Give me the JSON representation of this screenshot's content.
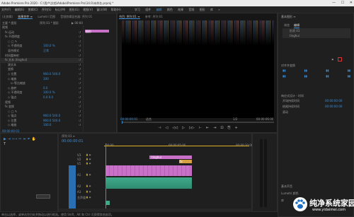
{
  "window": {
    "title": "Adobe Premiere Pro 2020 - C:\\用户\\文档\\Adobe\\Premiere Pro\\14.0\\未命名.prproj *",
    "controls": [
      "—",
      "☐",
      "✕"
    ]
  },
  "menu": [
    "文件(F)",
    "编辑(E)",
    "剪辑(C)",
    "序列(S)",
    "标记(M)",
    "图形(G)",
    "视图(V)",
    "窗口(W)",
    "帮助(H)"
  ],
  "workspaces": [
    "学习",
    "组件",
    "编辑",
    "颜色",
    "效果",
    "音频",
    "图形",
    "库",
    "»"
  ],
  "left_tabs": [
    "(无剪辑)",
    "效果控件 ≡",
    "Lumetri 范围",
    "音频剪辑混合器: 序列 01"
  ],
  "ec": {
    "source": "主要 * 图形",
    "seq": "序列 01 * 图形",
    "time": "▶ 00:00",
    "rows": [
      {
        "label": "视频",
        "indent": 0,
        "bold": true
      },
      {
        "label": "fx 运动",
        "indent": 1
      },
      {
        "label": "fx 不透明度",
        "indent": 1
      },
      {
        "label": "○ □ ✎",
        "indent": 2
      },
      {
        "label": "◇ 不透明度",
        "indent": 2,
        "value": "100.0 %"
      },
      {
        "label": "混合模式",
        "indent": 2,
        "value": "正常"
      },
      {
        "label": "时间重映射",
        "indent": 1
      },
      {
        "label": "fx 文本 (tinghui)",
        "indent": 1,
        "value": "",
        "hl": true
      },
      {
        "label": "源文本",
        "indent": 2
      },
      {
        "label": "变换",
        "indent": 2
      },
      {
        "label": "◇ 位置",
        "indent": 2,
        "value": "960.0   540.0"
      },
      {
        "label": "◇ 缩放",
        "indent": 2,
        "value": "100"
      },
      {
        "label": "☑ 等比缩放",
        "indent": 3
      },
      {
        "label": "◇ 旋转",
        "indent": 2,
        "value": "0.0"
      },
      {
        "label": "◇ 不透明度",
        "indent": 2,
        "value": "100.0 %"
      },
      {
        "label": "◇ 锚点",
        "indent": 2,
        "value": "0.0   0.0"
      },
      {
        "label": "视频",
        "indent": 1
      },
      {
        "label": "fx 变换",
        "indent": 1
      },
      {
        "label": "○ □ ✎",
        "indent": 2
      },
      {
        "label": "◇ 锚点",
        "indent": 2,
        "value": "960.0   540.0"
      },
      {
        "label": "◇ 位置",
        "indent": 2,
        "value": "960.0   540.0"
      },
      {
        "label": "◇ 缩放",
        "indent": 2,
        "value": "100.0"
      }
    ],
    "bottom_time": "00:00:00:01"
  },
  "clip_bar": "图形",
  "program": {
    "tabs": [
      "节目: 序列 01 ≡",
      "参考: 序列 01"
    ],
    "tc_left": "00:00:00:01",
    "fit": "适合",
    "full": "1/2",
    "tc_right": "00:00:06:00",
    "transport": [
      "⊣",
      "◁",
      "◁◁",
      "▷",
      "▷▷",
      "⊢",
      "⇤",
      "⇥",
      "⊡",
      "⎘",
      "+"
    ]
  },
  "timeline": {
    "tab": "序列 01 ≡",
    "tc": "00:00:00:01",
    "ruler": [
      "00:00",
      "00:00:05:00",
      "00:00:10:00"
    ],
    "tracks": [
      "V3",
      "V2",
      "V1",
      "A1",
      "A2",
      "A3",
      "主声道"
    ],
    "clips": [
      {
        "name": "tinghui",
        "track": "V3"
      },
      {
        "name": "fx",
        "track": "V2"
      },
      {
        "name": "",
        "track": "V1"
      }
    ],
    "master": "0.0"
  },
  "essential": {
    "tabs": [
      "基本图形 ≡",
      "浏览",
      "编辑"
    ],
    "layer_group": "图层",
    "layers": [
      "形状 01",
      "tinghui"
    ],
    "align_label": "对齐并变换",
    "style_label": "样式",
    "text_label": "文本",
    "responsive": "响应式设计 - 时间",
    "resp_rows": [
      {
        "label": "开场持续时间",
        "value": "00:00:00:00"
      },
      {
        "label": "结尾持续时间",
        "value": "00:00:00:00"
      },
      {
        "label": "滚动",
        "value": ""
      }
    ],
    "bottom": [
      "基本声音",
      "Lumetri 颜色",
      "库"
    ]
  },
  "status": "单击以选择，或单击空白处并拖动以进行框选。使用 Shift、Alt 和 Ctrl 可获得其他选项。",
  "watermark": {
    "cn": "纯净系统家园",
    "url": "www.yidaimei.com"
  },
  "colors": {
    "accent": "#3d8fd8",
    "clip_magenta": "#c971c9",
    "audio_green": "#3fa98a",
    "highlight": "#e0b020",
    "red_button": "#e03030"
  }
}
